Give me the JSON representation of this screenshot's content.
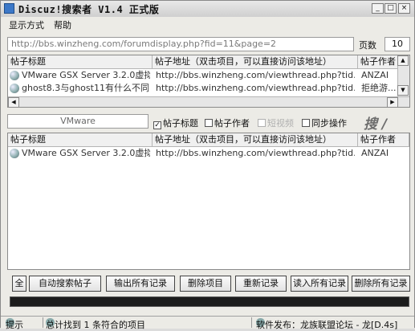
{
  "window": {
    "title": "Discuz!搜索者 V1.4 正式版",
    "min": "_",
    "max": "□",
    "close": "×"
  },
  "menu": [
    "显示方式",
    "帮助"
  ],
  "url": {
    "value": "http://bbs.winzheng.com/forumdisplay.php?fid=11&page=2"
  },
  "pages": {
    "label": "页数",
    "value": "10"
  },
  "columns": [
    "帖子标题",
    "帖子地址（双击项目，可以直接访问该地址）",
    "帖子作者"
  ],
  "top_list": [
    {
      "title": "VMware GSX Server 3.2.0虚拟...",
      "url": "http://bbs.winzheng.com/viewthread.php?tid...",
      "author": "ANZAI"
    },
    {
      "title": "ghost8.3与ghost11有什么不同...",
      "url": "http://bbs.winzheng.com/viewthread.php?tid...",
      "author": "拒绝游..."
    }
  ],
  "search": {
    "keyword": "VMware",
    "opt_title": "帖子标题",
    "opt_author": "帖子作者",
    "opt_disabled": "短视频",
    "opt_sync": "同步操作",
    "button": "搜 /"
  },
  "bottom_list": [
    {
      "title": "VMware GSX Server 3.2.0虚拟...",
      "url": "http://bbs.winzheng.com/viewthread.php?tid...",
      "author": "ANZAI"
    }
  ],
  "buttons": {
    "all": "全",
    "auto_search": "自动搜索帖子",
    "export_all": "输出所有记录",
    "delete_item": "删除项目",
    "reset": "重新记录",
    "load_all": "读入所有记录",
    "delete_all": "删除所有记录"
  },
  "progress": 1.0,
  "status": {
    "hint": "提示",
    "result": "总计找到 1 条符合的项目",
    "publisher": "软件发布：龙族联盟论坛 - 龙[D.4s]"
  }
}
